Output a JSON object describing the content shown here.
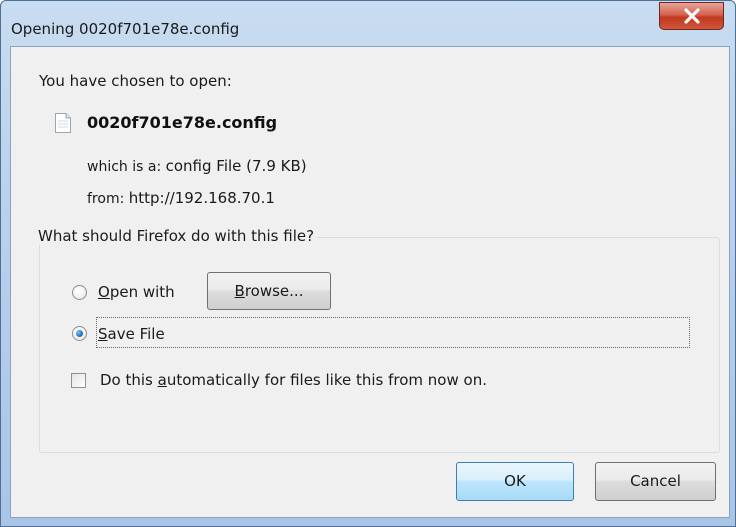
{
  "window": {
    "title": "Opening 0020f701e78e.config",
    "close_glyph": "X"
  },
  "dialog": {
    "intro": "You have chosen to open:",
    "file_name": "0020f701e78e.config",
    "file_icon": "document-icon",
    "type_prefix": "which is a:",
    "type_value": "config File (7.9 KB)",
    "from_prefix": "from:",
    "from_value": "http://192.168.70.1"
  },
  "action_group": {
    "legend": "What should Firefox do with this file?",
    "open_with": {
      "mnemonic": "O",
      "rest": "pen with",
      "selected": false
    },
    "browse_button": {
      "mnemonic": "B",
      "rest": "rowse..."
    },
    "save_file": {
      "mnemonic": "S",
      "rest": "ave File",
      "selected": true
    },
    "auto_checkbox": {
      "before": "Do this ",
      "mnemonic": "a",
      "after": "utomatically for files like this from now on.",
      "checked": false
    }
  },
  "buttons": {
    "ok": "OK",
    "cancel": "Cancel"
  },
  "colors": {
    "title_frame": "#b9d1ec",
    "close_button": "#c0391f",
    "dialog_background": "#f0f0f0",
    "radio_selected": "#1d72c2",
    "ok_button_border": "#3c7fb1"
  }
}
